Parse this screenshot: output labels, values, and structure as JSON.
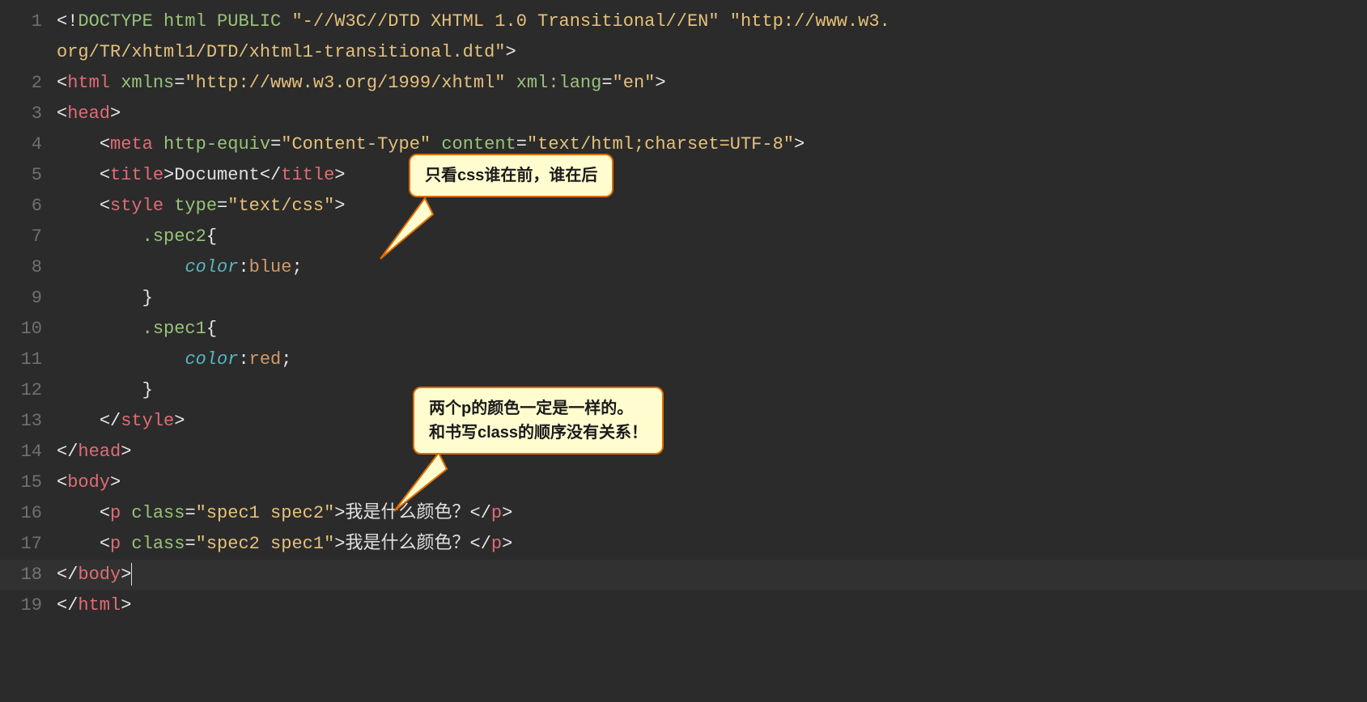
{
  "gutter": {
    "l1": "1",
    "l2": "2",
    "l3": "3",
    "l4": "4",
    "l5": "5",
    "l6": "6",
    "l7": "7",
    "l8": "8",
    "l9": "9",
    "l10": "10",
    "l11": "11",
    "l12": "12",
    "l13": "13",
    "l14": "14",
    "l15": "15",
    "l16": "16",
    "l17": "17",
    "l18": "18",
    "l19": "19"
  },
  "code": {
    "l1": {
      "a": "<!",
      "b": "DOCTYPE ",
      "c": "html ",
      "d": "PUBLIC ",
      "e": "\"-//W3C//DTD XHTML 1.0 Transitional//EN\"",
      "f": " ",
      "g": "\"http://www.w3.",
      "g2": "org/TR/xhtml1/DTD/xhtml1-transitional.dtd\"",
      "h": ">"
    },
    "l2": {
      "a": "<",
      "b": "html ",
      "c": "xmlns",
      "d": "=",
      "e": "\"http://www.w3.org/1999/xhtml\"",
      "f": " ",
      "g": "xml:lang",
      "h": "=",
      "i": "\"en\"",
      "j": ">"
    },
    "l3": {
      "a": "<",
      "b": "head",
      "c": ">"
    },
    "l4": {
      "indent": "    ",
      "a": "<",
      "b": "meta ",
      "c": "http-equiv",
      "d": "=",
      "e": "\"Content-Type\"",
      "f": " ",
      "g": "content",
      "h": "=",
      "i": "\"text/html;charset=UTF-8\"",
      "j": ">"
    },
    "l5": {
      "indent": "    ",
      "a": "<",
      "b": "title",
      "c": ">",
      "d": "Document",
      "e": "</",
      "f": "title",
      "g": ">"
    },
    "l6": {
      "indent": "    ",
      "a": "<",
      "b": "style ",
      "c": "type",
      "d": "=",
      "e": "\"text/css\"",
      "f": ">"
    },
    "l7": {
      "indent": "        ",
      "a": ".spec2",
      "b": "{"
    },
    "l8": {
      "indent": "            ",
      "a": "color",
      "b": ":",
      "c": "blue",
      "d": ";"
    },
    "l9": {
      "indent": "        ",
      "a": "}"
    },
    "l10": {
      "indent": "        ",
      "a": ".spec1",
      "b": "{"
    },
    "l11": {
      "indent": "            ",
      "a": "color",
      "b": ":",
      "c": "red",
      "d": ";"
    },
    "l12": {
      "indent": "        ",
      "a": "}"
    },
    "l13": {
      "indent": "    ",
      "a": "</",
      "b": "style",
      "c": ">"
    },
    "l14": {
      "a": "</",
      "b": "head",
      "c": ">"
    },
    "l15": {
      "a": "<",
      "b": "body",
      "c": ">"
    },
    "l16": {
      "indent": "    ",
      "a": "<",
      "b": "p ",
      "c": "class",
      "d": "=",
      "e": "\"spec1 spec2\"",
      "f": ">",
      "g": "我是什么颜色？",
      "h": "</",
      "i": "p",
      "j": ">"
    },
    "l17": {
      "indent": "    ",
      "a": "<",
      "b": "p ",
      "c": "class",
      "d": "=",
      "e": "\"spec2 spec1\"",
      "f": ">",
      "g": "我是什么颜色？",
      "h": "</",
      "i": "p",
      "j": ">"
    },
    "l18": {
      "a": "</",
      "b": "body",
      "c": ">"
    },
    "l19": {
      "a": "</",
      "b": "html",
      "c": ">"
    }
  },
  "callouts": {
    "c1": {
      "text": "只看css谁在前，谁在后"
    },
    "c2": {
      "line1": "两个p的颜色一定是一样的。",
      "line2": "和书写class的顺序没有关系！"
    }
  }
}
